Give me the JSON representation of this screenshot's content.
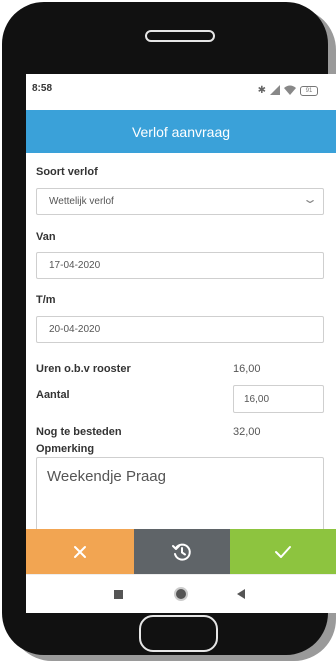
{
  "status_bar": {
    "time": "8:58",
    "icons": [
      "bluetooth-icon",
      "signal-icon",
      "wifi-icon",
      "battery-icon"
    ],
    "battery_level": "91"
  },
  "app_bar": {
    "title": "Verlof aanvraag",
    "color": "#3aa1d9"
  },
  "form": {
    "type": {
      "label": "Soort verlof",
      "value": "Wettelijk verlof"
    },
    "from": {
      "label": "Van",
      "value": "17-04-2020"
    },
    "until": {
      "label": "T/m",
      "value": "20-04-2020"
    },
    "roster_hours": {
      "label": "Uren o.b.v rooster",
      "value": "16,00"
    },
    "amount": {
      "label": "Aantal",
      "value": "16,00"
    },
    "remaining": {
      "label": "Nog te besteden",
      "value": "32,00"
    },
    "remark": {
      "label": "Opmerking",
      "value": "Weekendje Praag"
    }
  },
  "actions": {
    "cancel": {
      "icon": "close-icon",
      "color": "#f2a552"
    },
    "history": {
      "icon": "history-icon",
      "color": "#5f6468"
    },
    "confirm": {
      "icon": "check-icon",
      "color": "#8dc43f"
    }
  },
  "nav_bar": {
    "icons": [
      "recents-icon",
      "home-icon",
      "back-icon"
    ]
  }
}
